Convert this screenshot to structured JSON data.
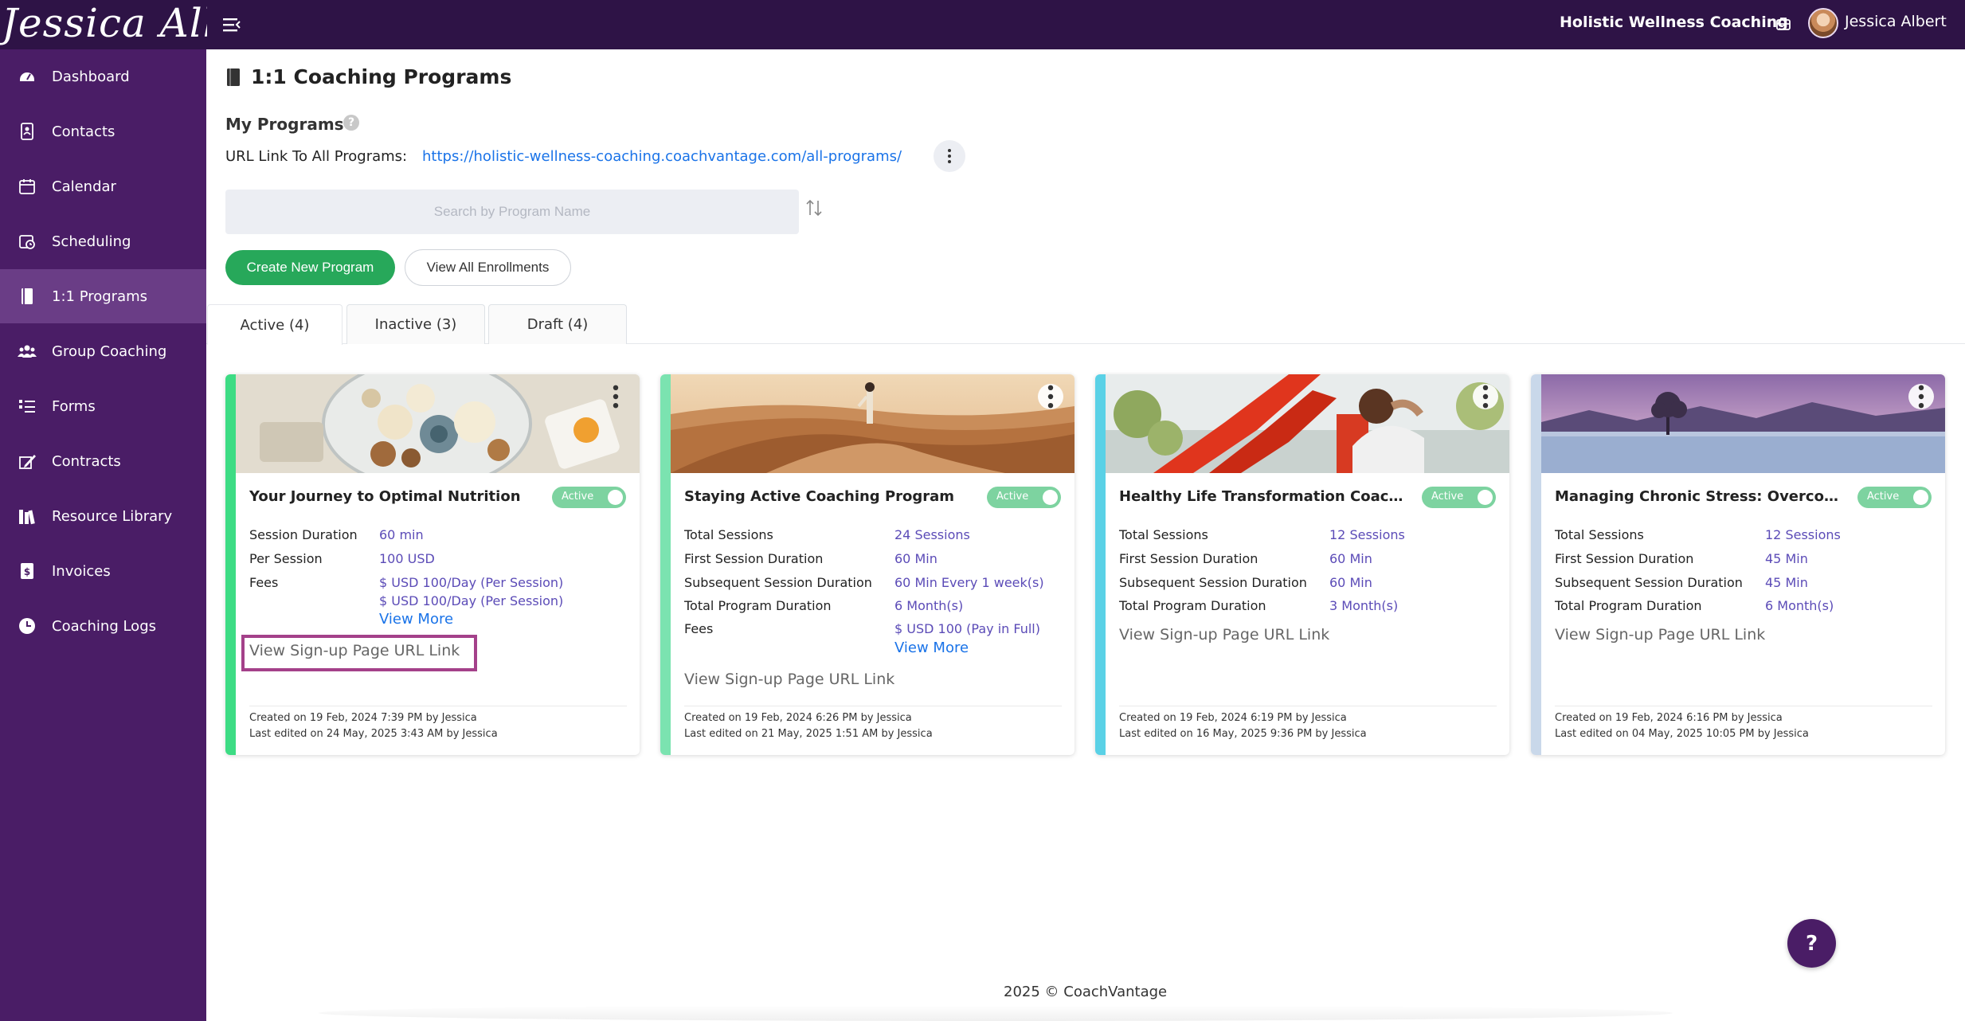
{
  "header": {
    "logo_text": "Jessica Albert",
    "brand": "Holistic Wellness Coaching",
    "user_name": "Jessica Albert"
  },
  "sidebar": {
    "items": [
      {
        "label": "Dashboard",
        "icon": "dashboard-icon"
      },
      {
        "label": "Contacts",
        "icon": "contacts-icon"
      },
      {
        "label": "Calendar",
        "icon": "calendar-icon"
      },
      {
        "label": "Scheduling",
        "icon": "scheduling-icon"
      },
      {
        "label": "1:1 Programs",
        "icon": "book-icon",
        "active": true
      },
      {
        "label": "Group Coaching",
        "icon": "group-icon"
      },
      {
        "label": "Forms",
        "icon": "forms-icon"
      },
      {
        "label": "Contracts",
        "icon": "contracts-icon"
      },
      {
        "label": "Resource Library",
        "icon": "library-icon"
      },
      {
        "label": "Invoices",
        "icon": "invoices-icon"
      },
      {
        "label": "Coaching Logs",
        "icon": "clock-icon"
      }
    ]
  },
  "page": {
    "title": "1:1 Coaching Programs",
    "section_title": "My Programs",
    "help_glyph": "?",
    "url_label": "URL Link To All Programs:",
    "url": "https://holistic-wellness-coaching.coachvantage.com/all-programs/",
    "search_placeholder": "Search by Program Name",
    "create_button": "Create New Program",
    "enrollments_button": "View All Enrollments"
  },
  "tabs": [
    {
      "label": "Active (4)",
      "active": true
    },
    {
      "label": "Inactive (3)",
      "active": false
    },
    {
      "label": "Draft (4)",
      "active": false
    }
  ],
  "cards": [
    {
      "title": "Your Journey to Optimal Nutrition",
      "status": "Active",
      "accent": "#3ddc84",
      "rows": [
        {
          "label": "Session Duration",
          "value": "60 min"
        },
        {
          "label": "Per Session",
          "value": "100 USD"
        },
        {
          "label": "Fees",
          "value": "$ USD 100/Day (Per Session)"
        },
        {
          "label": "",
          "value": "$ USD 100/Day (Per Session)"
        }
      ],
      "view_more": "View More",
      "signup_link": "View Sign-up Page URL Link",
      "created": "Created on 19 Feb, 2024 7:39 PM by Jessica",
      "edited": "Last edited on 24 May, 2025 3:43 AM by Jessica"
    },
    {
      "title": "Staying Active Coaching Program",
      "status": "Active",
      "accent": "#7be3b0",
      "rows": [
        {
          "label": "Total Sessions",
          "value": "24 Sessions"
        },
        {
          "label": "First Session Duration",
          "value": "60 Min"
        },
        {
          "label": "Subsequent Session Duration",
          "value": "60 Min Every 1 week(s)"
        },
        {
          "label": "Total Program Duration",
          "value": "6 Month(s)"
        },
        {
          "label": "Fees",
          "value": "$ USD 100 (Pay in Full)"
        }
      ],
      "view_more": "View More",
      "signup_link": "View Sign-up Page URL Link",
      "created": "Created on 19 Feb, 2024 6:26 PM by Jessica",
      "edited": "Last edited on 21 May, 2025 1:51 AM by Jessica"
    },
    {
      "title": "Healthy Life Transformation Coaching Program",
      "status": "Active",
      "accent": "#5ad1e6",
      "rows": [
        {
          "label": "Total Sessions",
          "value": "12 Sessions"
        },
        {
          "label": "First Session Duration",
          "value": "60 Min"
        },
        {
          "label": "Subsequent Session Duration",
          "value": "60 Min"
        },
        {
          "label": "Total Program Duration",
          "value": "3 Month(s)"
        }
      ],
      "view_more": "",
      "signup_link": "View Sign-up Page URL Link",
      "created": "Created on 19 Feb, 2024 6:19 PM by Jessica",
      "edited": "Last edited on 16 May, 2025 9:36 PM by Jessica"
    },
    {
      "title": "Managing Chronic Stress: Overcome Burnout",
      "status": "Active",
      "accent": "#c9d8ea",
      "rows": [
        {
          "label": "Total Sessions",
          "value": "12 Sessions"
        },
        {
          "label": "First Session Duration",
          "value": "45 Min"
        },
        {
          "label": "Subsequent Session Duration",
          "value": "45 Min"
        },
        {
          "label": "Total Program Duration",
          "value": "6 Month(s)"
        }
      ],
      "view_more": "",
      "signup_link": "View Sign-up Page URL Link",
      "created": "Created on 19 Feb, 2024 6:16 PM by Jessica",
      "edited": "Last edited on 04 May, 2025 10:05 PM by Jessica"
    }
  ],
  "footer": {
    "text": "2025 © CoachVantage"
  },
  "help_fab": "?"
}
